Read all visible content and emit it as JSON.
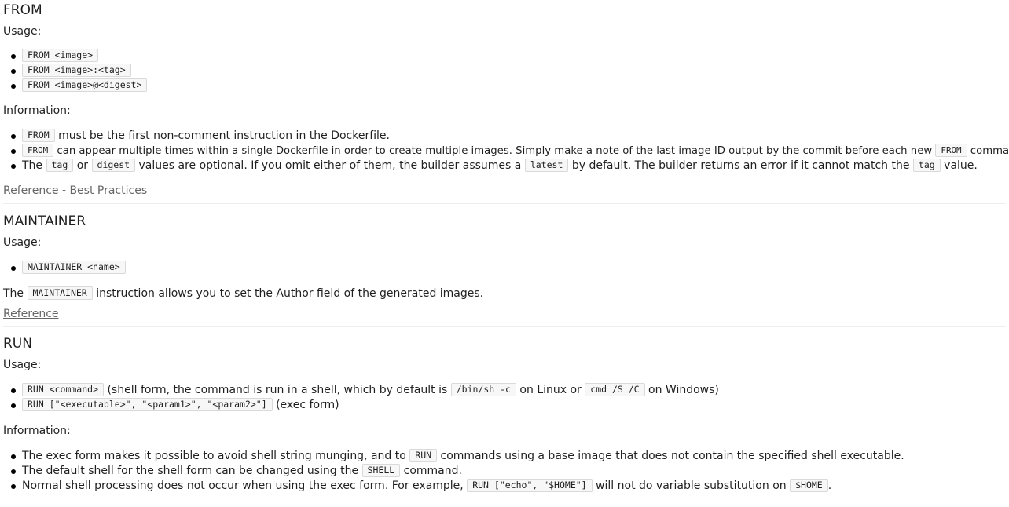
{
  "from": {
    "title": "FROM",
    "usage_label": "Usage:",
    "usage": [
      "FROM <image>",
      "FROM <image>:<tag>",
      "FROM <image>@<digest>"
    ],
    "info_label": "Information:",
    "info1": {
      "code": "FROM",
      "text": " must be the first non-comment instruction in the Dockerfile."
    },
    "info2": {
      "code1": "FROM",
      "text1": " can appear multiple times within a single Dockerfile in order to create multiple images. Simply make a note of the last image ID output by the commit before each new ",
      "code2": "FROM",
      "text2": " command."
    },
    "info3": {
      "t1": "The ",
      "c1": "tag",
      "t2": " or ",
      "c2": "digest",
      "t3": " values are optional. If you omit either of them, the builder assumes a ",
      "c3": "latest",
      "t4": " by default. The builder returns an error if it cannot match the ",
      "c4": "tag",
      "t5": " value."
    },
    "links": {
      "reference": "Reference",
      "dash": " - ",
      "best_practices": "Best Practices"
    }
  },
  "maintainer": {
    "title": "MAINTAINER",
    "usage_label": "Usage:",
    "usage": [
      "MAINTAINER <name>"
    ],
    "desc": {
      "t1": "The ",
      "c1": "MAINTAINER",
      "t2": " instruction allows you to set the Author field of the generated images."
    },
    "links": {
      "reference": "Reference"
    }
  },
  "run": {
    "title": "RUN",
    "usage_label": "Usage:",
    "usage1": {
      "c1": "RUN <command>",
      "t1": " (shell form, the command is run in a shell, which by default is ",
      "c2": "/bin/sh -c",
      "t2": " on Linux or ",
      "c3": "cmd /S /C",
      "t3": " on Windows)"
    },
    "usage2": {
      "c1": "RUN [\"<executable>\", \"<param1>\", \"<param2>\"]",
      "t1": " (exec form)"
    },
    "info_label": "Information:",
    "info1": {
      "t1": "The exec form makes it possible to avoid shell string munging, and to ",
      "c1": "RUN",
      "t2": " commands using a base image that does not contain the specified shell executable."
    },
    "info2": {
      "t1": "The default shell for the shell form can be changed using the ",
      "c1": "SHELL",
      "t2": " command."
    },
    "info3": {
      "t1": "Normal shell processing does not occur when using the exec form. For example, ",
      "c1": "RUN [\"echo\", \"$HOME\"]",
      "t2": " will not do variable substitution on ",
      "c2": "$HOME",
      "t3": "."
    }
  }
}
